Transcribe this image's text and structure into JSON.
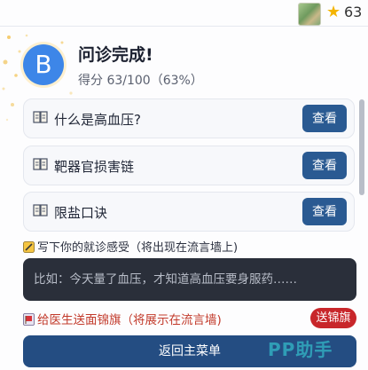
{
  "topbar": {
    "score": "63"
  },
  "result": {
    "avatar_letter": "B",
    "title": "问诊完成!",
    "score_text": "得分 63/100（63%）"
  },
  "items": [
    {
      "label": "什么是高血压?",
      "button": "查看"
    },
    {
      "label": "靶器官损害链",
      "button": "查看"
    },
    {
      "label": "限盐口诀",
      "button": "查看"
    }
  ],
  "feedback": {
    "prompt": "写下你的就诊感受（将出现在流言墙上)",
    "placeholder": "比如：今天量了血压，才知道高血压要身服药……"
  },
  "banner": {
    "prompt": "给医生送面锦旗（将展示在流言墙)",
    "button": "送锦旗"
  },
  "main_button": "返回主菜单",
  "watermark": "PP助手",
  "colors": {
    "accent_blue": "#2a5a92",
    "banner_red": "#c8262a",
    "avatar_blue": "#3d86e8"
  }
}
